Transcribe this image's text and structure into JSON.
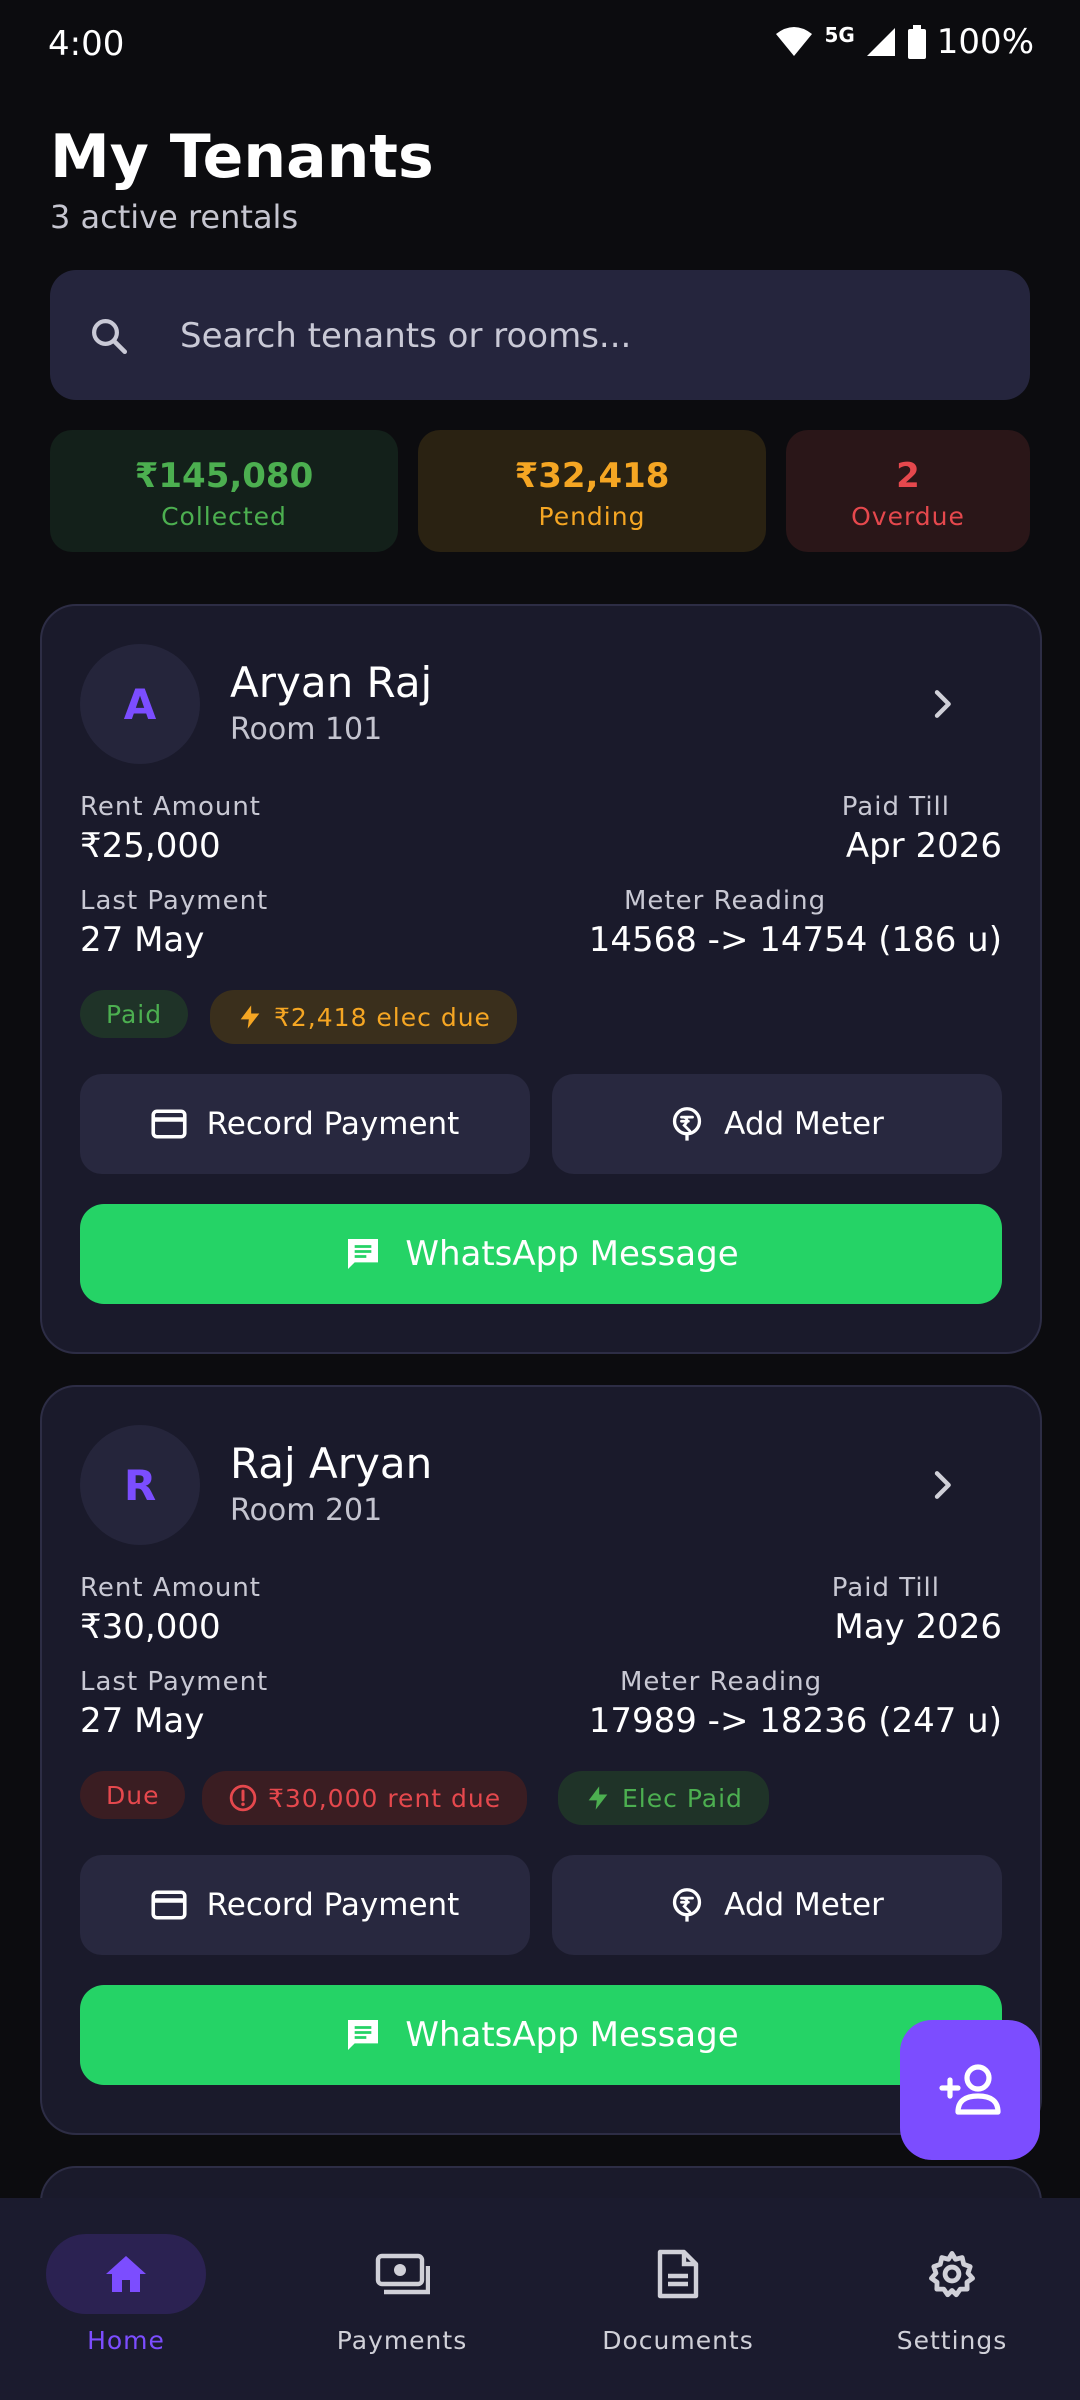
{
  "status_bar": {
    "time": "4:00",
    "network": "5G",
    "battery": "100%"
  },
  "header": {
    "title": "My Tenants",
    "subtitle": "3 active rentals"
  },
  "search": {
    "placeholder": "Search tenants or rooms..."
  },
  "stats": [
    {
      "value": "₹145,080",
      "label": "Collected",
      "color": "#4caf50"
    },
    {
      "value": "₹32,418",
      "label": "Pending",
      "color": "#f5a623"
    },
    {
      "value": "2",
      "label": "Overdue",
      "color": "#e5484d"
    }
  ],
  "labels": {
    "rent_amount": "Rent Amount",
    "paid_till": "Paid Till",
    "last_payment": "Last Payment",
    "meter_reading": "Meter Reading",
    "record_payment": "Record Payment",
    "add_meter": "Add Meter",
    "whatsapp": "WhatsApp Message"
  },
  "tenants": [
    {
      "initial": "A",
      "name": "Aryan Raj",
      "room": "Room 101",
      "rent": "₹25,000",
      "paid_till": "Apr 2026",
      "last_payment": "27 May",
      "meter": "14568 -> 14754 (186 u)",
      "status": "Paid",
      "rent_due": "",
      "elec": "₹2,418 elec due"
    },
    {
      "initial": "R",
      "name": "Raj Aryan",
      "room": "Room 201",
      "rent": "₹30,000",
      "paid_till": "May 2026",
      "last_payment": "27 May",
      "meter": "17989 -> 18236 (247 u)",
      "status": "Due",
      "rent_due": "₹30,000 rent due",
      "elec": "Elec Paid"
    }
  ],
  "nav": [
    {
      "label": "Home",
      "icon": "home-icon",
      "active": true
    },
    {
      "label": "Payments",
      "icon": "payments-icon"
    },
    {
      "label": "Documents",
      "icon": "document-icon"
    },
    {
      "label": "Settings",
      "icon": "gear-icon"
    }
  ],
  "colors": {
    "accent": "#7c4dff",
    "whatsapp": "#25d366",
    "paid": "#4caf50",
    "due": "#e5484d",
    "warning": "#f5a623"
  }
}
